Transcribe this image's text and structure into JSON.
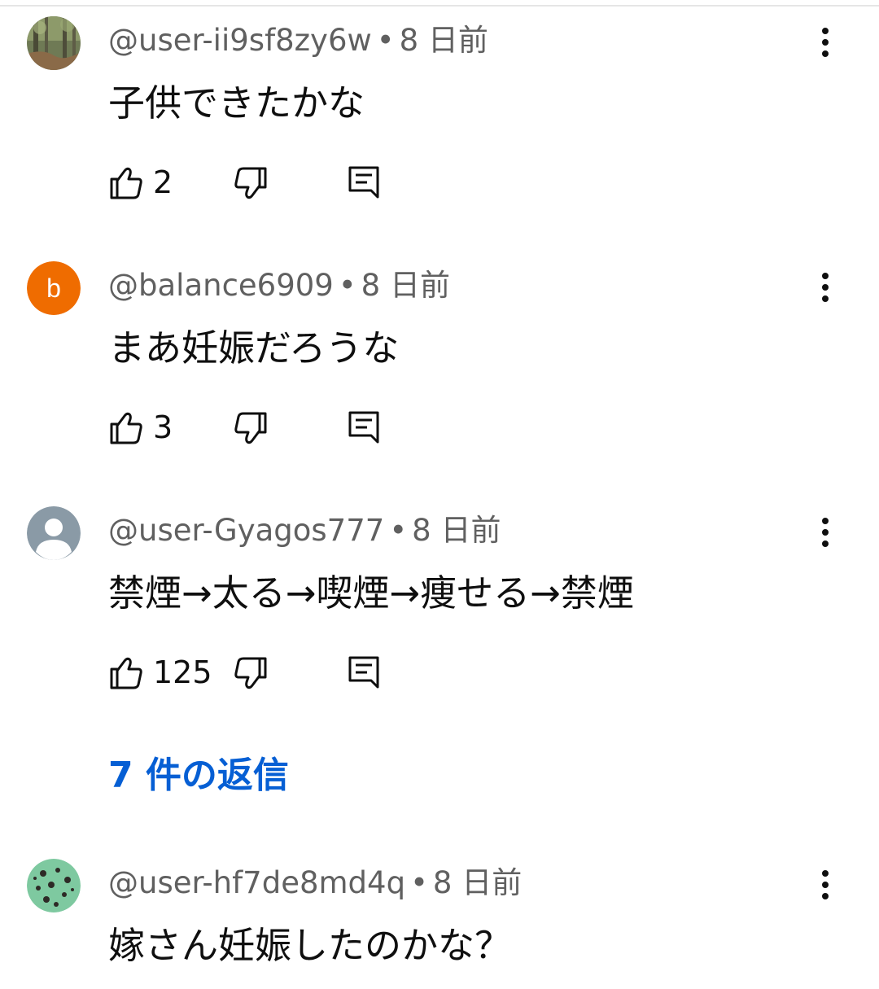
{
  "comments": [
    {
      "handle": "@user-ii9sf8zy6w",
      "time": "8 日前",
      "separator": "•",
      "text": "子供できたかな",
      "likes": "2",
      "avatar_type": "photo-forest"
    },
    {
      "handle": "@balance6909",
      "time": "8 日前",
      "separator": "•",
      "text": "まあ妊娠だろうな",
      "likes": "3",
      "avatar_type": "letter",
      "avatar_letter": "b",
      "avatar_color": "#ef6c00"
    },
    {
      "handle": "@user-Gyagos777",
      "time": "8 日前",
      "separator": "•",
      "text": "禁煙→太る→喫煙→痩せる→禁煙",
      "likes": "125",
      "avatar_type": "default-person"
    },
    {
      "handle": "@user-hf7de8md4q",
      "time": "8 日前",
      "separator": "•",
      "text": "嫁さん妊娠したのかな？",
      "avatar_type": "photo-mint"
    }
  ],
  "replies_link": "7 件の返信",
  "colors": {
    "meta": "#606060",
    "text": "#0f0f0f",
    "link": "#065fd4",
    "avatar_orange": "#ef6c00",
    "avatar_gray": "#8a9aa6"
  },
  "icons": {
    "like": "thumbs-up-icon",
    "dislike": "thumbs-down-icon",
    "reply": "comment-reply-icon",
    "menu": "more-vert-icon"
  }
}
